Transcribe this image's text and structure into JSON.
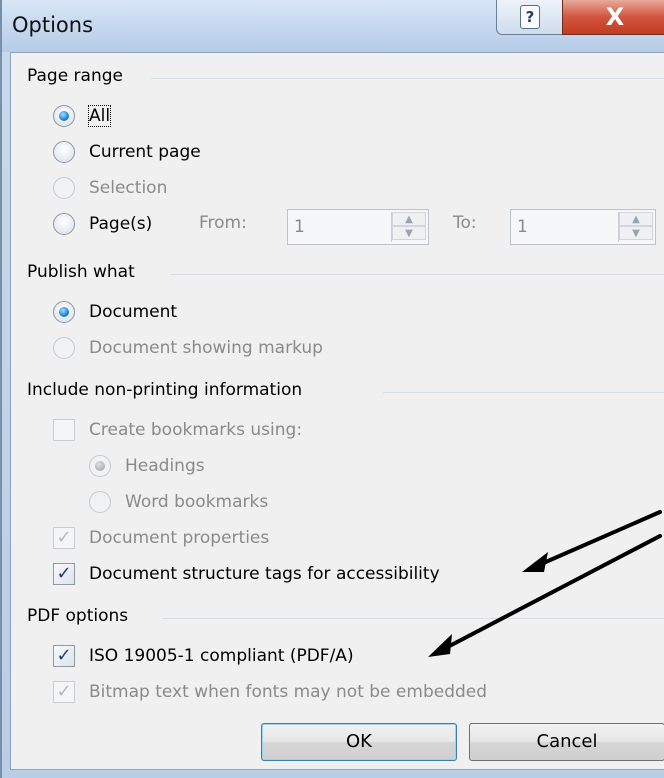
{
  "window": {
    "title": "Options",
    "help_glyph": "?",
    "close_glyph": "X"
  },
  "page_range": {
    "label": "Page range",
    "options": [
      "All",
      "Current page",
      "Selection",
      "Page(s)"
    ],
    "from_label": "From:",
    "from_value": "1",
    "to_label": "To:",
    "to_value": "1",
    "selected": "All"
  },
  "publish_what": {
    "label": "Publish what",
    "options": [
      "Document",
      "Document showing markup"
    ],
    "selected": "Document"
  },
  "non_printing": {
    "label": "Include non-printing information",
    "create_bookmarks": "Create bookmarks using:",
    "headings": "Headings",
    "word_bookmarks": "Word bookmarks",
    "doc_properties": "Document properties",
    "structure_tags": "Document structure tags for accessibility"
  },
  "pdf_options": {
    "label": "PDF options",
    "iso": "ISO 19005-1 compliant (PDF/A)",
    "bitmap": "Bitmap text when fonts may not be embedded"
  },
  "buttons": {
    "ok": "OK",
    "cancel": "Cancel"
  },
  "colors": {
    "frame": "#c3d6ee",
    "close": "#c23b22",
    "client": "#f0f0f0",
    "radio_selected": "#2a8ad6"
  }
}
